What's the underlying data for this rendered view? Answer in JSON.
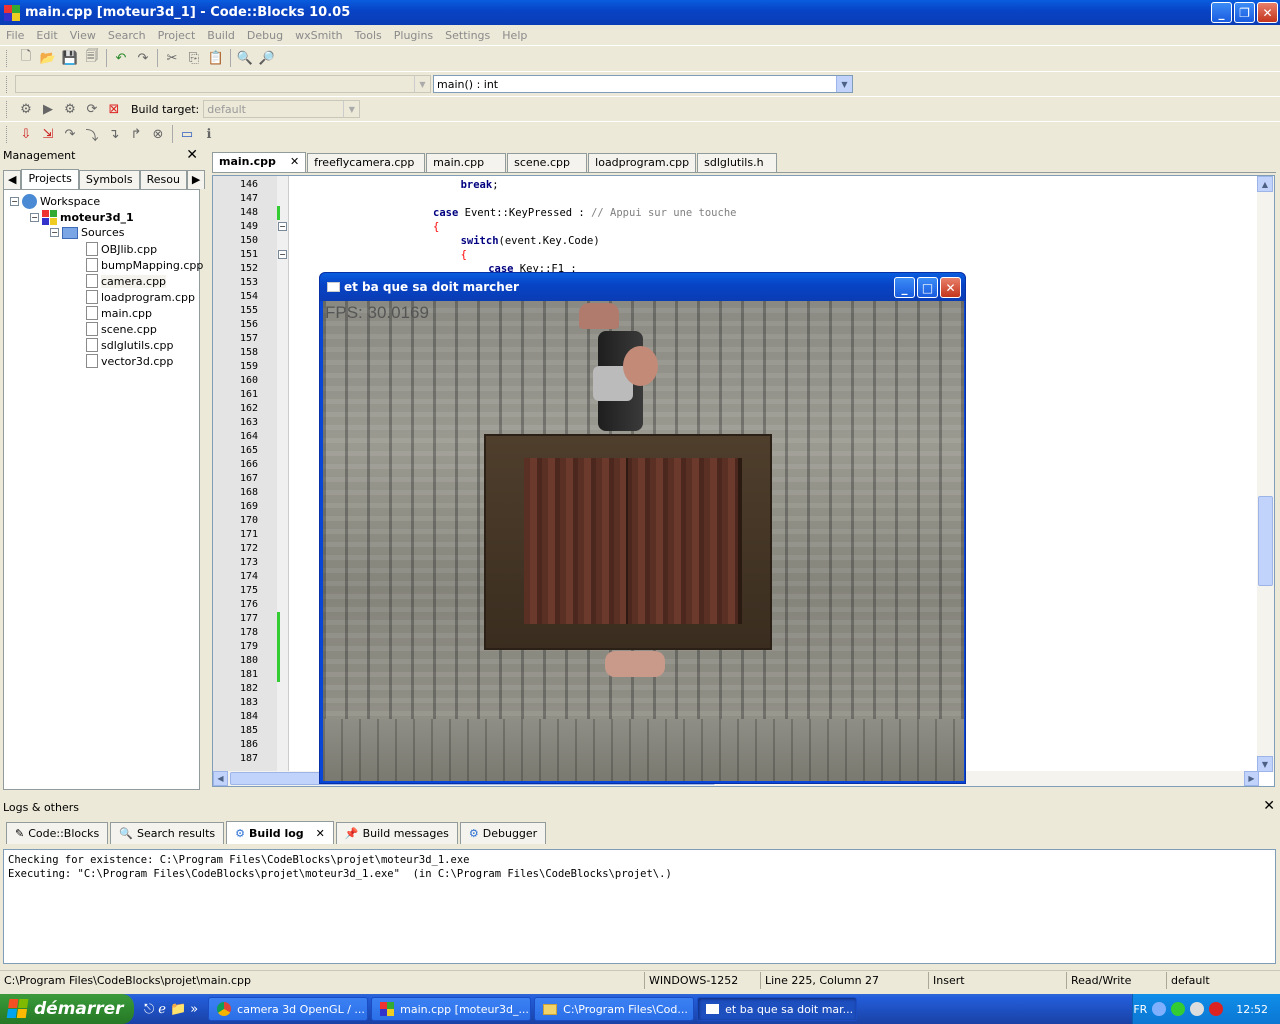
{
  "window": {
    "title": "main.cpp [moteur3d_1] - Code::Blocks 10.05"
  },
  "menu": [
    "File",
    "Edit",
    "View",
    "Search",
    "Project",
    "Build",
    "Debug",
    "wxSmith",
    "Tools",
    "Plugins",
    "Settings",
    "Help"
  ],
  "code_combo": {
    "value": "main() : int"
  },
  "build_target": {
    "label": "Build target:",
    "value": "default"
  },
  "management": {
    "title": "Management",
    "tabs": [
      "Projects",
      "Symbols",
      "Resou"
    ],
    "tree": {
      "workspace": "Workspace",
      "project": "moteur3d_1",
      "folder": "Sources",
      "files": [
        "OBJlib.cpp",
        "bumpMapping.cpp",
        "camera.cpp",
        "loadprogram.cpp",
        "main.cpp",
        "scene.cpp",
        "sdlglutils.cpp",
        "vector3d.cpp"
      ]
    }
  },
  "editor_tabs": [
    "main.cpp",
    "freeflycamera.cpp",
    "main.cpp",
    "scene.cpp",
    "loadprogram.cpp",
    "sdlglutils.h"
  ],
  "code": {
    "line_numbers": [
      "146",
      "147",
      "148",
      "149",
      "150",
      "151",
      "152",
      "153",
      "154",
      "155",
      "156",
      "157",
      "158",
      "159",
      "160",
      "161",
      "162",
      "163",
      "164",
      "165",
      "166",
      "167",
      "168",
      "169",
      "170",
      "171",
      "172",
      "173",
      "174",
      "175",
      "176",
      "177",
      "178",
      "179",
      "180",
      "181",
      "182",
      "183",
      "184",
      "185",
      "186",
      "187"
    ],
    "lines": [
      {
        "line": "146",
        "kw": "break",
        "rest": ";",
        "indent": 24
      },
      {
        "line": "148",
        "kw": "case",
        "rest": " Event::KeyPressed : ",
        "comment": "// Appui sur une touche",
        "indent": 20
      },
      {
        "line": "149",
        "rest": "{",
        "indent": 20,
        "op": true
      },
      {
        "line": "150",
        "kw": "switch",
        "rest": "(event.Key.Code)",
        "indent": 24
      },
      {
        "line": "151",
        "rest": "{",
        "indent": 24,
        "op": true
      },
      {
        "line": "152",
        "kw": "case",
        "rest": " Key::F1 :",
        "indent": 28
      }
    ]
  },
  "game_window": {
    "title": "et ba que sa doit marcher",
    "fps_text": "FPS: 30.0169"
  },
  "logs": {
    "title": "Logs & others",
    "tabs": [
      "Code::Blocks",
      "Search results",
      "Build log",
      "Build messages",
      "Debugger"
    ],
    "active_tab": "Build log",
    "lines": [
      "Checking for existence: C:\\Program Files\\CodeBlocks\\projet\\moteur3d_1.exe",
      "Executing: \"C:\\Program Files\\CodeBlocks\\projet\\moteur3d_1.exe\"  (in C:\\Program Files\\CodeBlocks\\projet\\.)"
    ]
  },
  "status": {
    "path": "C:\\Program Files\\CodeBlocks\\projet\\main.cpp",
    "encoding": "WINDOWS-1252",
    "position": "Line 225, Column 27",
    "mode": "Insert",
    "access": "Read/Write",
    "target": "default"
  },
  "taskbar": {
    "start_label": "démarrer",
    "items": [
      "camera 3d OpenGL / ...",
      "main.cpp [moteur3d_...",
      "C:\\Program Files\\Cod...",
      "et ba que sa doit mar..."
    ],
    "lang": "FR",
    "clock": "12:52"
  }
}
